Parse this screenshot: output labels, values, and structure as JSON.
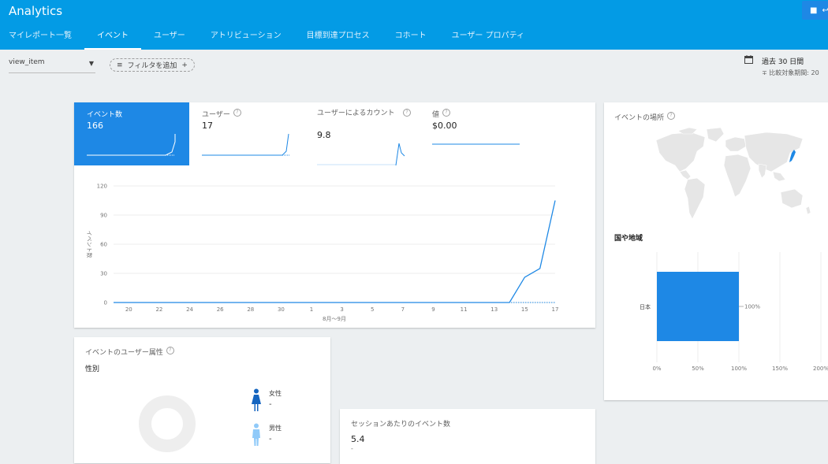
{
  "header": {
    "title": "Analytics",
    "button_label": "↩",
    "tabs": [
      {
        "label": "マイレポート一覧",
        "active": false
      },
      {
        "label": "イベント",
        "active": true
      },
      {
        "label": "ユーザー",
        "active": false
      },
      {
        "label": "アトリビューション",
        "active": false
      },
      {
        "label": "目標到達プロセス",
        "active": false
      },
      {
        "label": "コホート",
        "active": false
      },
      {
        "label": "ユーザー プロパティ",
        "active": false
      }
    ]
  },
  "toolbar": {
    "event_select_value": "view_item",
    "filter_label": "フィルタを追加",
    "filter_add_glyph": "+",
    "date_range_label": "過去 30 日間",
    "compare_label": "比較対象期間: 20"
  },
  "metrics": {
    "tabs": [
      {
        "label": "イベント数",
        "value": "166",
        "active": true
      },
      {
        "label": "ユーザー",
        "value": "17",
        "active": false
      },
      {
        "label": "ユーザーによるカウント",
        "value": "9.8",
        "active": false
      },
      {
        "label": "値",
        "value": "$0.00",
        "active": false
      }
    ],
    "help_glyph": "?"
  },
  "chart_data": {
    "type": "line",
    "title": "",
    "xlabel": "8月〜9月",
    "ylabel": "イベント数",
    "ylim": [
      0,
      120
    ],
    "yticks": [
      0,
      30,
      60,
      90,
      120
    ],
    "xtick_labels": [
      "20",
      "22",
      "24",
      "26",
      "28",
      "30",
      "1",
      "3",
      "5",
      "7",
      "9",
      "11",
      "13",
      "15",
      "17"
    ],
    "x": [
      "8/19",
      "8/20",
      "8/21",
      "8/22",
      "8/23",
      "8/24",
      "8/25",
      "8/26",
      "8/27",
      "8/28",
      "8/29",
      "8/30",
      "8/31",
      "9/1",
      "9/2",
      "9/3",
      "9/4",
      "9/5",
      "9/6",
      "9/7",
      "9/8",
      "9/9",
      "9/10",
      "9/11",
      "9/12",
      "9/13",
      "9/14",
      "9/15",
      "9/16",
      "9/17"
    ],
    "series": [
      {
        "values": [
          0,
          0,
          0,
          0,
          0,
          0,
          0,
          0,
          0,
          0,
          0,
          0,
          0,
          0,
          0,
          0,
          0,
          0,
          0,
          0,
          0,
          0,
          0,
          0,
          0,
          0,
          0,
          26,
          35,
          105
        ],
        "color": "#1e88e5",
        "style": "solid"
      },
      {
        "values": [
          0,
          0,
          0,
          0,
          0,
          0,
          0,
          0,
          0,
          0,
          0,
          0,
          0,
          0,
          0,
          0,
          0,
          0,
          0,
          0,
          0,
          0,
          0,
          0,
          0,
          0,
          0,
          0,
          0,
          0
        ],
        "color": "#1e88e5",
        "style": "dotted"
      }
    ]
  },
  "location": {
    "title": "イベントの場所",
    "region_label": "国や地域",
    "bar_chart": {
      "type": "bar",
      "categories": [
        "日本"
      ],
      "values": [
        100
      ],
      "value_labels": [
        "100%"
      ],
      "xtick_labels": [
        "0%",
        "50%",
        "100%",
        "150%",
        "200%"
      ],
      "xlim": [
        0,
        200
      ]
    }
  },
  "demographics": {
    "title": "イベントのユーザー属性",
    "gender_label": "性別",
    "female_label": "女性",
    "female_value": "-",
    "male_label": "男性",
    "male_value": "-"
  },
  "session": {
    "title": "セッションあたりのイベント数",
    "value": "5.4",
    "sub": "-"
  },
  "colors": {
    "header": "#039be5",
    "accent": "#1e88e5",
    "female": "#1565c0",
    "male": "#90caf9"
  }
}
